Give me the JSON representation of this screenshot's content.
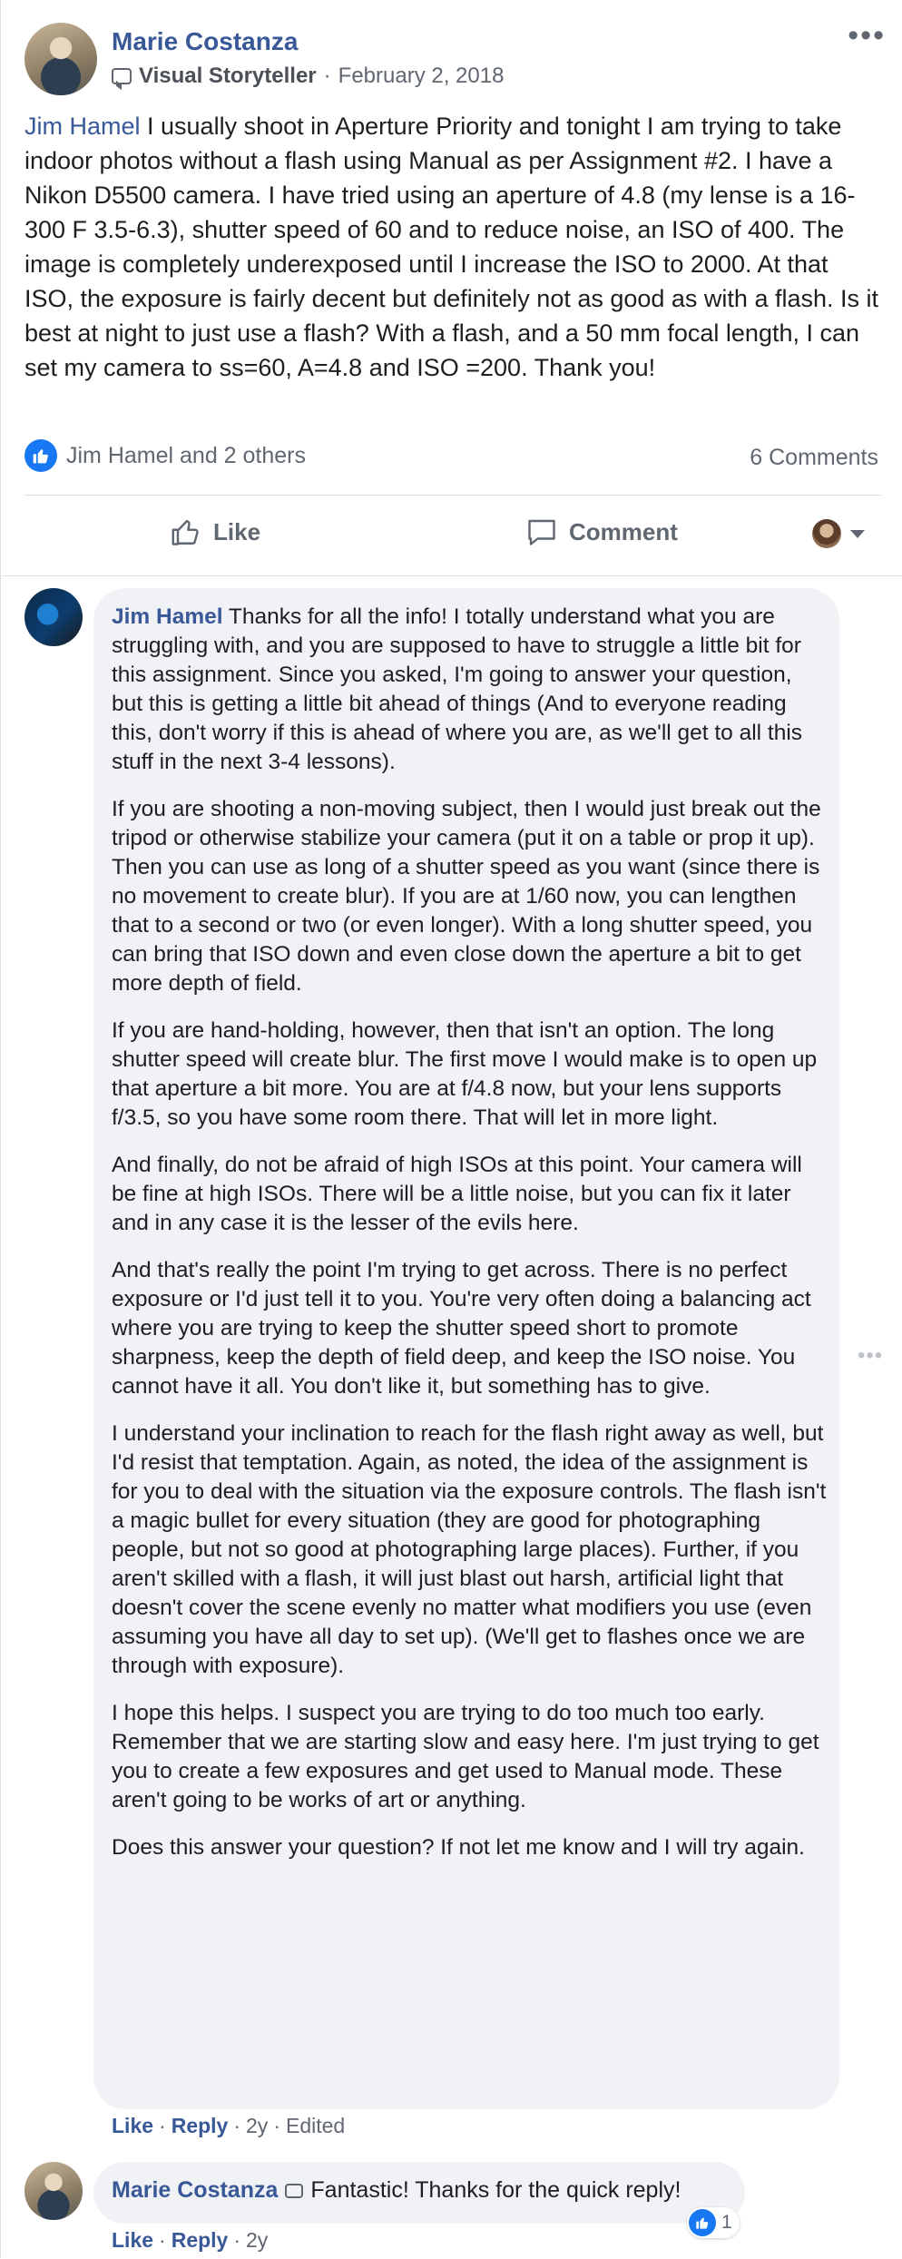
{
  "post": {
    "author": "Marie Costanza",
    "badge_label": "Visual Storyteller",
    "separator": "·",
    "date": "February 2, 2018",
    "mention": "Jim Hamel",
    "text": " I usually shoot in Aperture Priority and tonight I am trying to take indoor photos without a flash using Manual as per Assignment #2. I have a Nikon D5500 camera. I have tried using an aperture of 4.8 (my lense is a 16-300 F 3.5-6.3), shutter speed of 60 and to reduce noise, an ISO of 400. The image is completely underexposed until I increase the ISO to 2000. At that ISO, the exposure is fairly decent but definitely not as good as with a flash. Is it best at night to just use a flash? With a flash, and a 50 mm focal length, I can set my camera to ss=60, A=4.8 and ISO =200. Thank you!",
    "reactions_text": "Jim Hamel and 2 others",
    "comments_count": "6 Comments"
  },
  "actions": {
    "like": "Like",
    "comment": "Comment"
  },
  "comment1": {
    "author": "Jim Hamel",
    "paragraphs": [
      " Thanks for all the info! I totally understand what you are struggling with, and you are supposed to have to struggle a little bit for this assignment. Since you asked, I'm going to answer your question, but this is getting a little bit ahead of things (And to everyone reading this, don't worry if this is ahead of where you are, as we'll get to all this stuff in the next 3-4 lessons).",
      "If you are shooting a non-moving subject, then I would just break out the tripod or otherwise stabilize your camera (put it on a table or prop it up). Then you can use as long of a shutter speed as you want (since there is no movement to create blur). If you are at 1/60 now, you can lengthen that to a second or two (or even longer). With a long shutter speed, you can bring that ISO down and even close down the aperture a bit to get more depth of field.",
      "If you are hand-holding, however, then that isn't an option. The long shutter speed will create blur. The first move I would make is to open up that aperture a bit more. You are at f/4.8 now, but your lens supports f/3.5, so you have some room there. That will let in more light.",
      "And finally, do not be afraid of high ISOs at this point. Your camera will be fine at high ISOs. There will be a little noise, but you can fix it later and in any case it is the lesser of the evils here.",
      "And that's really the point I'm trying to get across. There is no perfect exposure or I'd just tell it to you. You're very often doing a balancing act where you are trying to keep the shutter speed short to promote sharpness, keep the depth of field deep, and keep the ISO noise. You cannot have it all. You don't like it, but something has to give.",
      "I understand your inclination to reach for the flash right away as well, but I'd resist that temptation. Again, as noted, the idea of the assignment is for you to deal with the situation via the exposure controls. The flash isn't a magic bullet for every situation (they are good for photographing people, but not so good at photographing large places). Further, if you aren't skilled with a flash, it will just blast out harsh, artificial light that doesn't cover the scene evenly no matter what modifiers you use (even assuming you have all day to set up). (We'll get to flashes once we are through with exposure).",
      "I hope this helps. I suspect you are trying to do too much too early.",
      "Remember that we are starting slow and easy here. I'm just trying to get you to create a few exposures and get used to Manual mode. These aren't going to be works of art or anything.",
      "Does this answer your question? If not let me know and I will try again."
    ],
    "like": "Like",
    "reply": "Reply",
    "age": "2y",
    "edited": "Edited",
    "dot": "·"
  },
  "comment2": {
    "author": "Marie Costanza",
    "text": "Fantastic! Thanks for the quick reply!",
    "reaction_count": "1",
    "like": "Like",
    "reply": "Reply",
    "age": "2y",
    "dot": "·"
  },
  "colors": {
    "link": "#385898",
    "like_blue": "#1877f2",
    "bubble": "#f0f2f5",
    "muted": "#606770"
  },
  "icons": [
    "more-options-icon",
    "visual-storyteller-badge-icon",
    "like-reaction-icon",
    "thumbs-up-icon",
    "comment-icon",
    "chevron-down-icon"
  ]
}
